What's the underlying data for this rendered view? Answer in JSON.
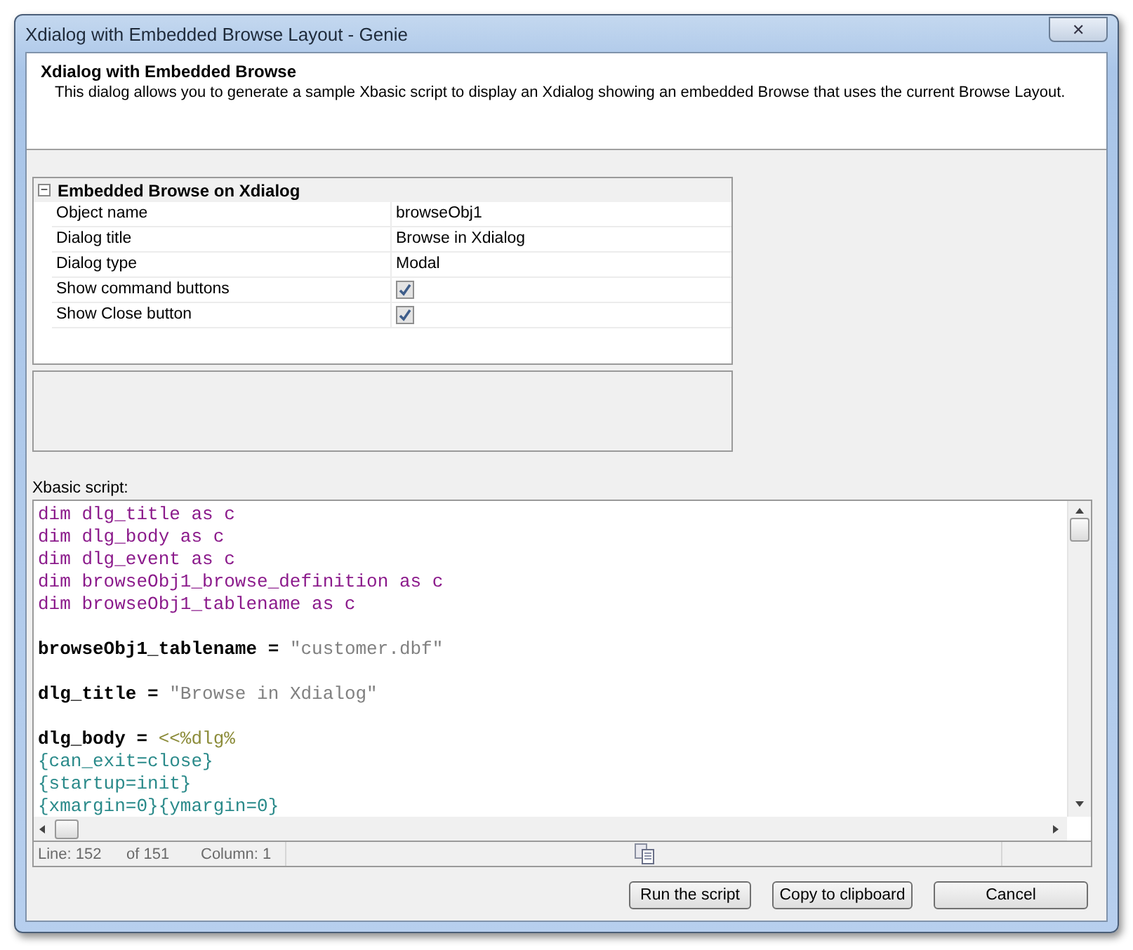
{
  "window": {
    "title": "Xdialog with Embedded Browse Layout - Genie",
    "close_label": "✕"
  },
  "header": {
    "title": "Xdialog with Embedded Browse",
    "description": "This dialog allows you to generate a sample Xbasic script to display an Xdialog showing an embedded Browse that uses the current Browse Layout."
  },
  "property_grid": {
    "category": "Embedded Browse on Xdialog",
    "expanded": true,
    "collapse_label": "−",
    "rows": [
      {
        "kind": "text",
        "label": "Object name",
        "value": "browseObj1"
      },
      {
        "kind": "text",
        "label": "Dialog title",
        "value": "Browse in Xdialog"
      },
      {
        "kind": "text",
        "label": "Dialog type",
        "value": "Modal"
      },
      {
        "kind": "checkbox",
        "label": "Show command buttons",
        "checked": true
      },
      {
        "kind": "checkbox",
        "label": "Show Close button",
        "checked": true
      }
    ]
  },
  "script": {
    "label": "Xbasic script:",
    "lines": [
      [
        {
          "kind": "keyword",
          "text": "dim dlg_title as c"
        }
      ],
      [
        {
          "kind": "keyword",
          "text": "dim dlg_body as c"
        }
      ],
      [
        {
          "kind": "keyword",
          "text": "dim dlg_event as c"
        }
      ],
      [
        {
          "kind": "keyword",
          "text": "dim browseObj1_browse_definition as c"
        }
      ],
      [
        {
          "kind": "keyword",
          "text": "dim browseObj1_tablename as c"
        }
      ],
      {
        "kind": "blank"
      },
      [
        {
          "kind": "plain",
          "text": "browseObj1_tablename = "
        },
        {
          "kind": "string",
          "text": "\"customer.dbf\""
        }
      ],
      {
        "kind": "blank"
      },
      [
        {
          "kind": "plain",
          "text": "dlg_title = "
        },
        {
          "kind": "string",
          "text": "\"Browse in Xdialog\""
        }
      ],
      {
        "kind": "blank"
      },
      [
        {
          "kind": "plain",
          "text": "dlg_body = "
        },
        {
          "kind": "heredoc",
          "text": "<<%dlg%"
        }
      ],
      [
        {
          "kind": "brace",
          "text": "{can_exit=close}"
        }
      ],
      [
        {
          "kind": "brace",
          "text": "{startup=init}"
        }
      ],
      [
        {
          "kind": "brace",
          "text": "{xmargin=0}{ymargin=0}"
        }
      ]
    ]
  },
  "status_bar": {
    "line": "Line: 152",
    "of": "of 151",
    "column": "Column: 1"
  },
  "buttons": [
    "Run the script",
    "Copy to clipboard",
    "Cancel"
  ]
}
